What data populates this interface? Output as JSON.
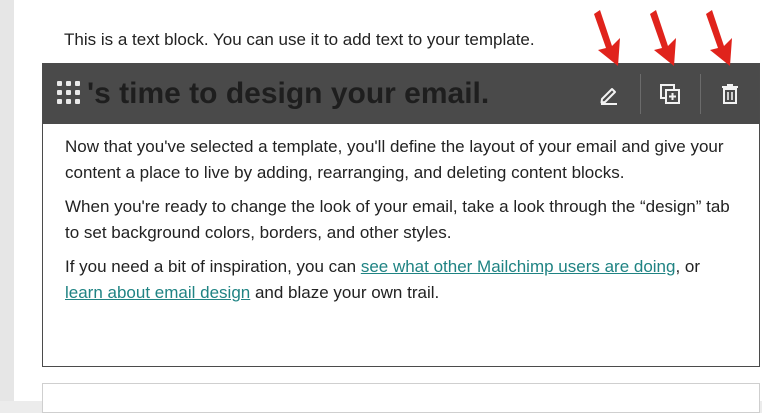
{
  "text_block": {
    "intro": "This is a text block. You can use it to add text to your template."
  },
  "selected_block": {
    "heading": "'s time to design your email.",
    "paragraph1": "Now that you've selected a template, you'll define the layout of your email and give your content a place to live by adding, rearranging, and deleting content blocks.",
    "paragraph2": "When you're ready to change the look of your email, take a look through the “design” tab to set background colors, borders, and other styles.",
    "paragraph3": {
      "before_link1": "If you need a bit of inspiration, you can ",
      "link1": "see what other Mailchimp users are doing",
      "between": ", or ",
      "link2": "learn about email design",
      "after": " and blaze your own trail."
    }
  },
  "toolbar": {
    "icons": [
      "drag-handle-icon",
      "edit-pencil-icon",
      "duplicate-icon",
      "trash-icon"
    ],
    "background_color": "#4a4a4a"
  },
  "annotation": {
    "arrow_color": "#e0231c"
  },
  "colors": {
    "link": "#1f8383"
  }
}
